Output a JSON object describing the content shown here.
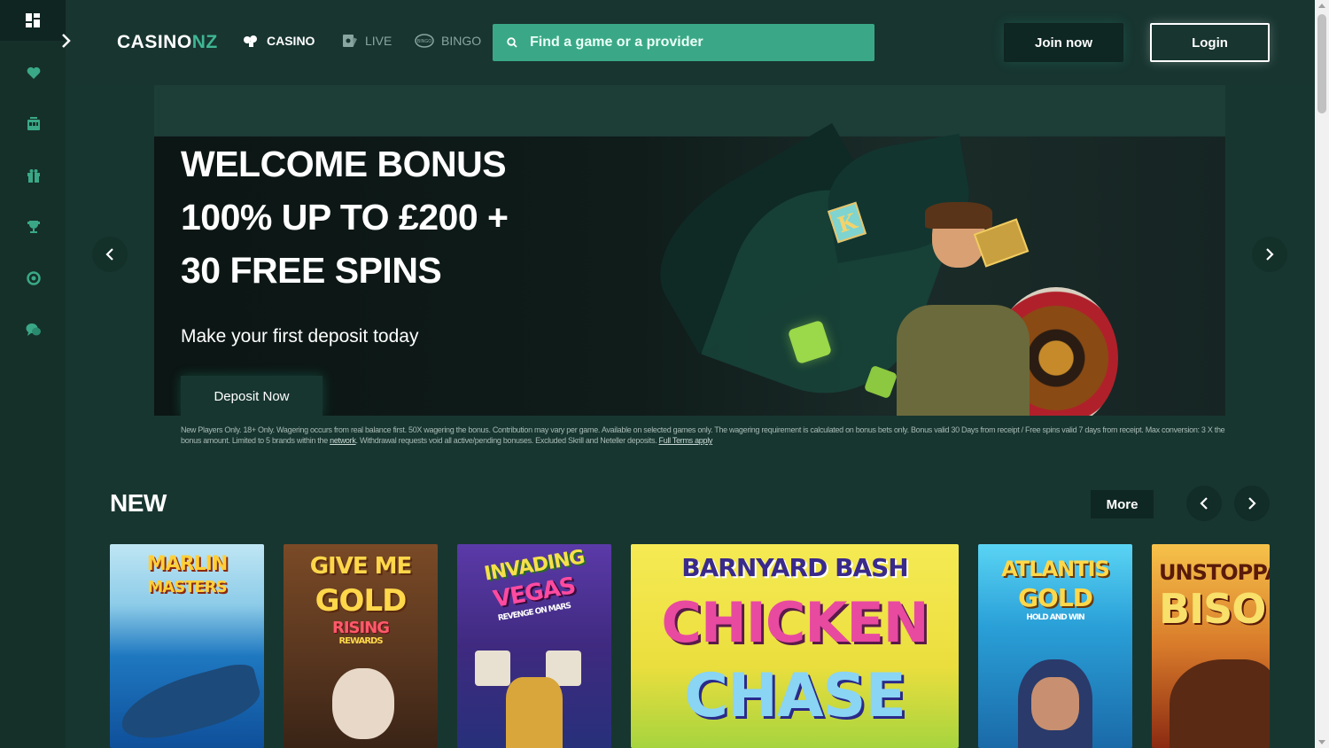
{
  "header": {
    "logo_main": "CASINO",
    "logo_accent": "NZ",
    "nav": [
      {
        "label": "CASINO",
        "icon": "cards-icon"
      },
      {
        "label": "LIVE",
        "icon": "live-dealer-icon"
      },
      {
        "label": "BINGO",
        "icon": "bingo-ball-icon"
      }
    ],
    "search_placeholder": "Find a game or a provider",
    "join_label": "Join now",
    "login_label": "Login"
  },
  "sidebar": {
    "items": [
      {
        "icon": "dashboard-icon"
      },
      {
        "icon": "heart-icon"
      },
      {
        "icon": "slot-machine-icon"
      },
      {
        "icon": "gift-icon"
      },
      {
        "icon": "trophy-icon"
      },
      {
        "icon": "lifebuoy-icon"
      },
      {
        "icon": "chat-support-icon"
      }
    ]
  },
  "banner": {
    "line1": "WELCOME BONUS",
    "line2": "100% UP TO £200 +",
    "line3": "30 FREE SPINS",
    "subtitle": "Make your first deposit today",
    "cta": "Deposit Now",
    "terms_text": "New Players Only. 18+ Only. Wagering occurs from real balance first. 50X wagering the bonus. Contribution may vary per game. Available on selected games only. The wagering requirement is calculated on bonus bets only. Bonus valid 30 Days from receipt / Free spins valid 7 days from receipt. Max conversion: 3 X the bonus amount. Limited to 5 brands within the",
    "terms_link1": "network",
    "terms_text2": ". Withdrawal requests void all active/pending bonuses. Excluded Skrill and Neteller deposits.",
    "terms_link2": "Full Terms apply"
  },
  "new_section": {
    "title": "NEW",
    "more_label": "More",
    "games": [
      {
        "title1": "MARLIN",
        "title2": "MASTERS",
        "color": "#1f7ec2"
      },
      {
        "title1": "GIVE ME",
        "title2": "GOLD",
        "title3": "RISING",
        "title4": "REWARDS",
        "color": "#5a3a22"
      },
      {
        "title1": "INVADING",
        "title2": "VEGAS",
        "title3": "REVENGE ON MARS",
        "color": "#4b2f8a"
      },
      {
        "title1": "BARNYARD BASH",
        "title2": "CHICKEN",
        "title3": "CHASE",
        "color": "#f3e640"
      },
      {
        "title1": "ATLANTIS",
        "title2": "GOLD",
        "title3": "HOLD AND WIN",
        "color": "#1f8dc4"
      },
      {
        "title1": "UNSTOPPA",
        "title2": "BISO",
        "color": "#a63a1c"
      }
    ]
  },
  "colors": {
    "accent": "#3aa886",
    "background": "#183530",
    "rail": "#153029"
  }
}
